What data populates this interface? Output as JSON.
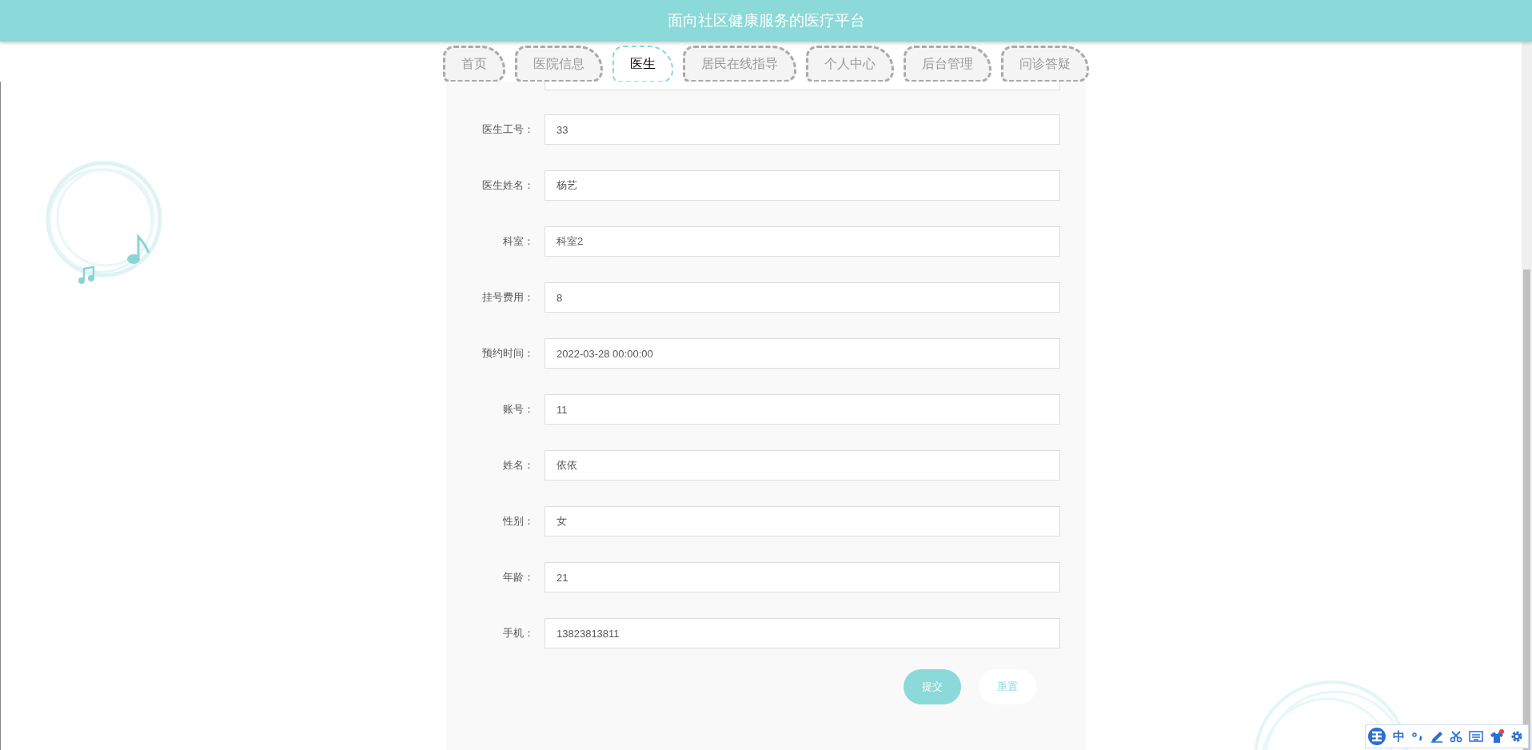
{
  "header": {
    "title": "面向社区健康服务的医疗平台"
  },
  "tabs": [
    {
      "label": "首页",
      "selected": false
    },
    {
      "label": "医院信息",
      "selected": false
    },
    {
      "label": "医生",
      "selected": true
    },
    {
      "label": "居民在线指导",
      "selected": false
    },
    {
      "label": "个人中心",
      "selected": false
    },
    {
      "label": "后台管理",
      "selected": false
    },
    {
      "label": "问诊答疑",
      "selected": false
    }
  ],
  "form": {
    "fields": [
      {
        "label": "医生工号：",
        "value": "33"
      },
      {
        "label": "医生姓名：",
        "value": "杨艺"
      },
      {
        "label": "科室：",
        "value": "科室2"
      },
      {
        "label": "挂号费用：",
        "value": "8"
      },
      {
        "label": "预约时间：",
        "value": "2022-03-28 00:00:00"
      },
      {
        "label": "账号：",
        "value": "11"
      },
      {
        "label": "姓名：",
        "value": "依依"
      },
      {
        "label": "性别：",
        "value": "女"
      },
      {
        "label": "年龄：",
        "value": "21"
      },
      {
        "label": "手机：",
        "value": "13823813811"
      }
    ],
    "buttons": [
      {
        "label": "提交",
        "kind": "primary"
      },
      {
        "label": "重置",
        "kind": "secondary"
      }
    ]
  },
  "ime_toolbar": {
    "mode": "中"
  }
}
